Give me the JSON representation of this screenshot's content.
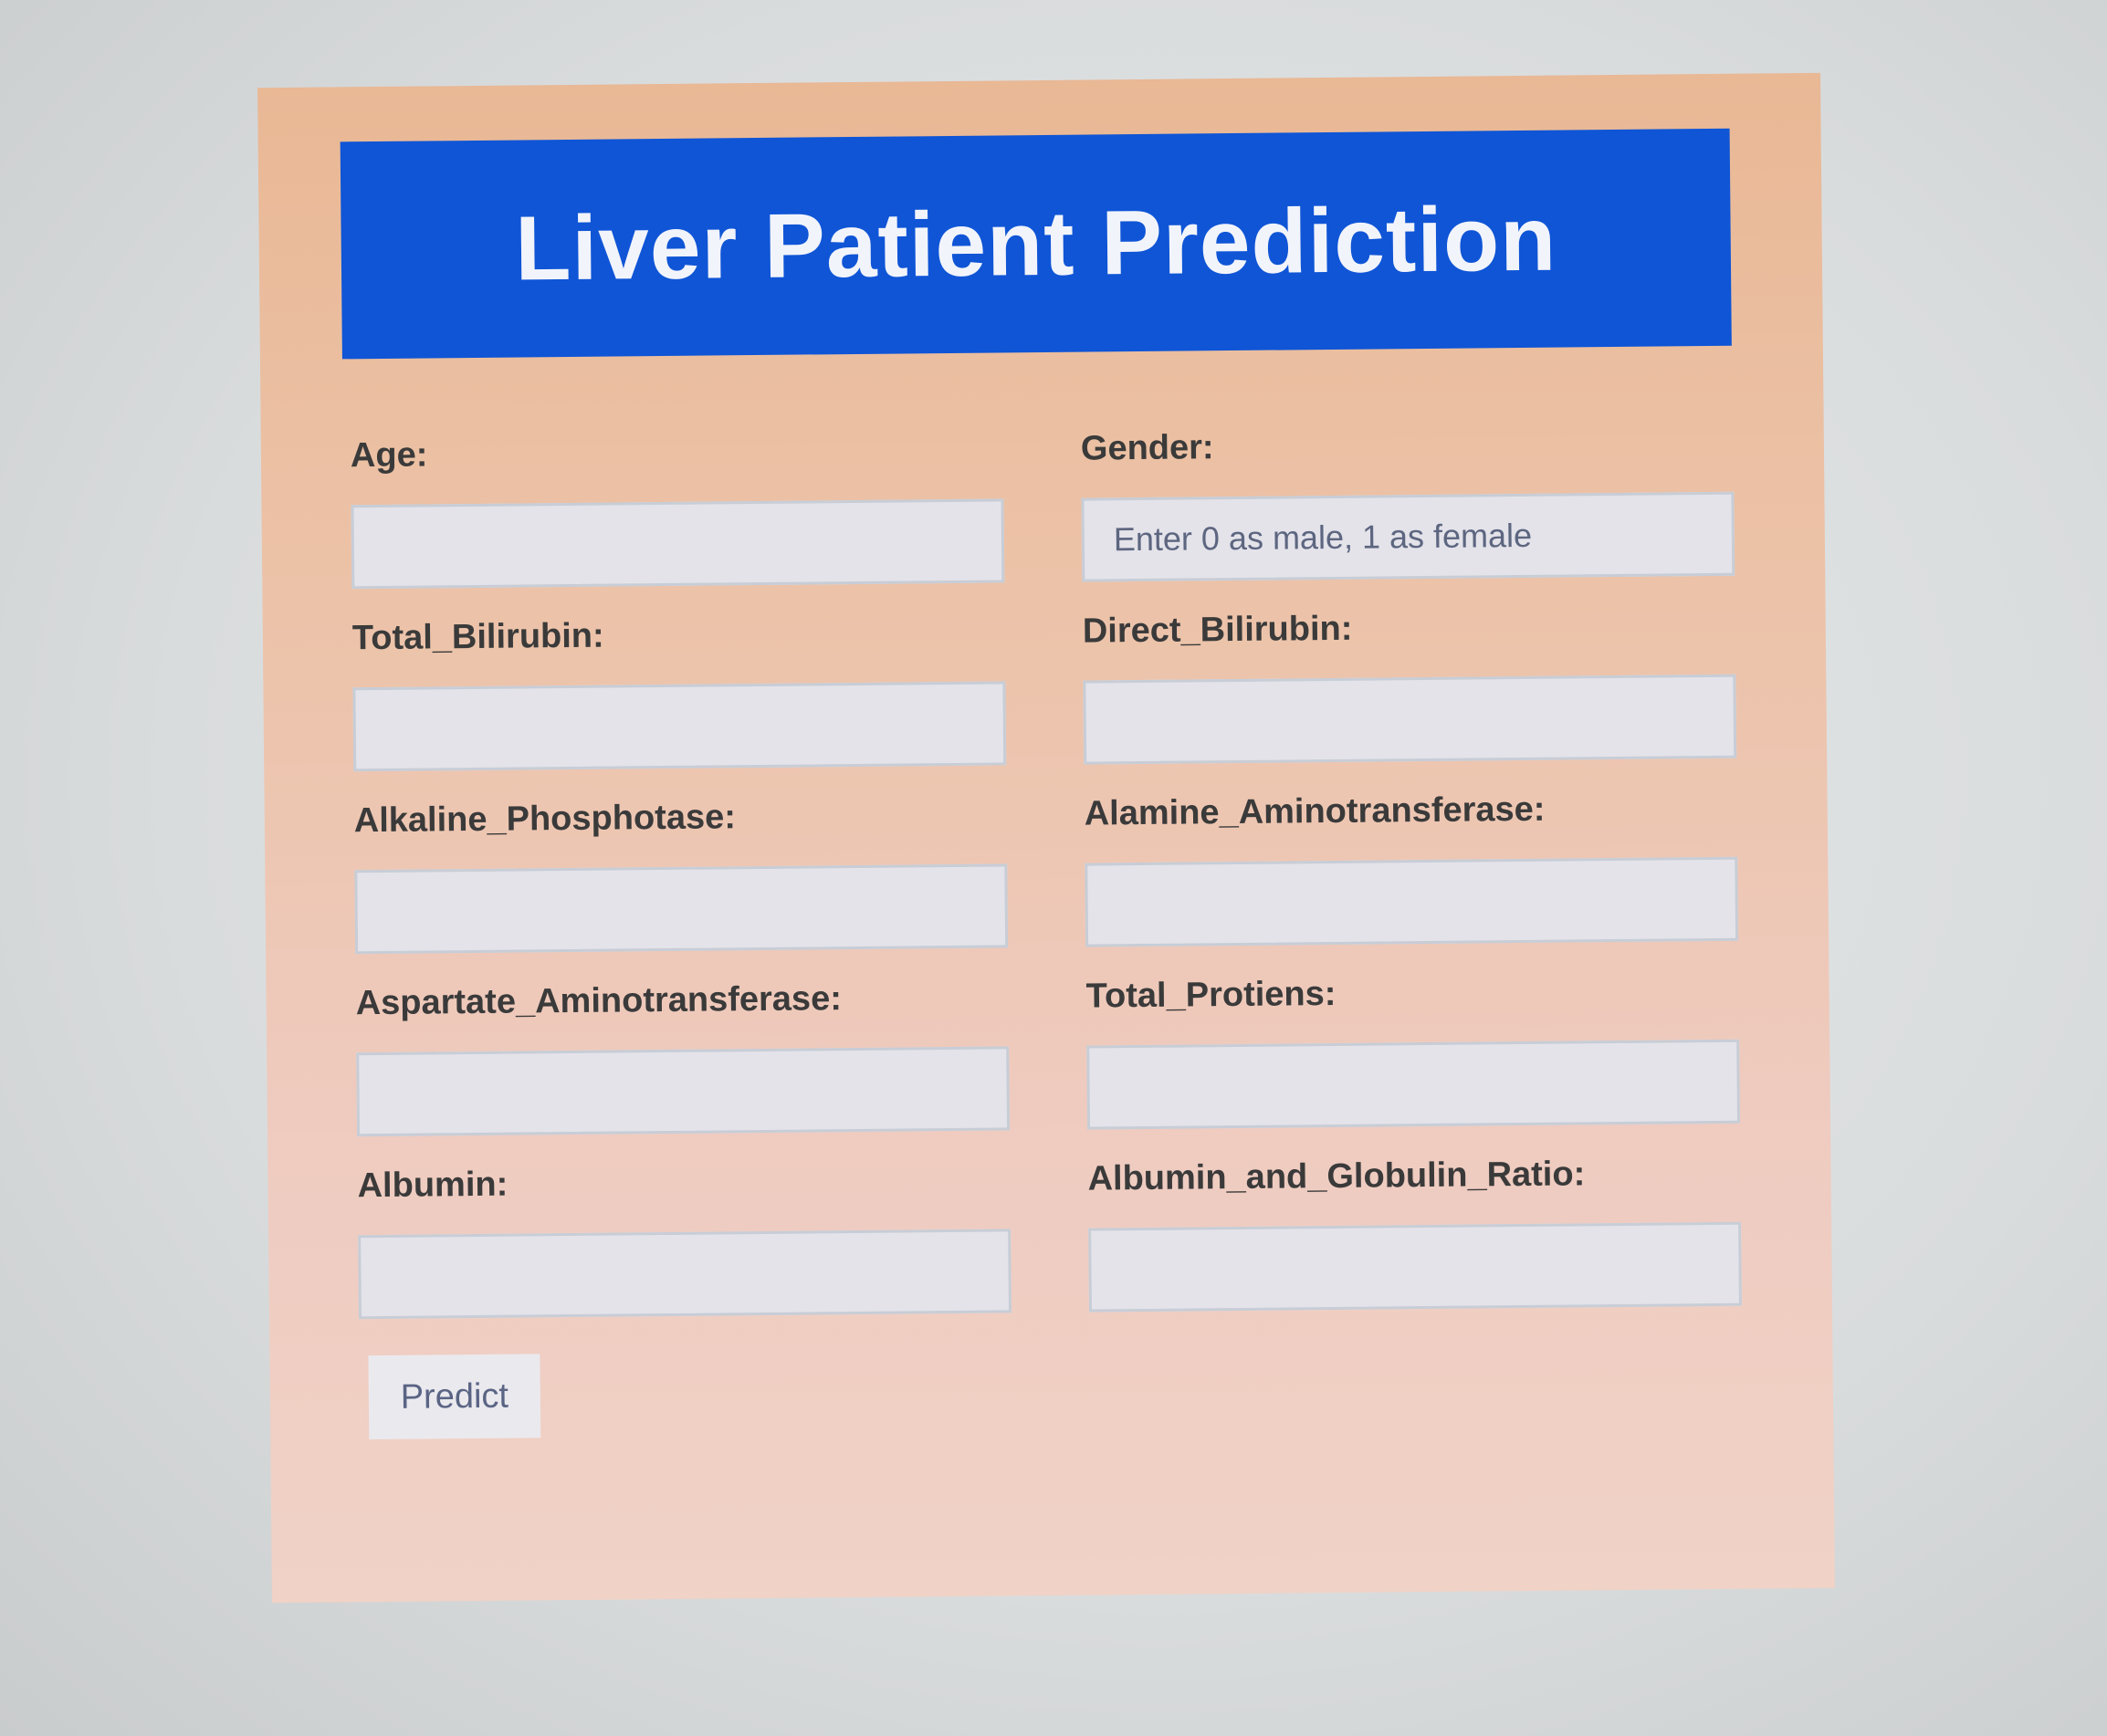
{
  "header": {
    "title": "Liver Patient Prediction"
  },
  "form": {
    "fields": [
      {
        "label": "Age:",
        "placeholder": "",
        "value": ""
      },
      {
        "label": "Gender:",
        "placeholder": "Enter 0 as male, 1 as female",
        "value": ""
      },
      {
        "label": "Total_Bilirubin:",
        "placeholder": "",
        "value": ""
      },
      {
        "label": "Direct_Bilirubin:",
        "placeholder": "",
        "value": ""
      },
      {
        "label": "Alkaline_Phosphotase:",
        "placeholder": "",
        "value": ""
      },
      {
        "label": "Alamine_Aminotransferase:",
        "placeholder": "",
        "value": ""
      },
      {
        "label": "Aspartate_Aminotransferase:",
        "placeholder": "",
        "value": ""
      },
      {
        "label": "Total_Protiens:",
        "placeholder": "",
        "value": ""
      },
      {
        "label": "Albumin:",
        "placeholder": "",
        "value": ""
      },
      {
        "label": "Albumin_and_Globulin_Ratio:",
        "placeholder": "",
        "value": ""
      }
    ],
    "submit_label": "Predict"
  },
  "colors": {
    "header_bg": "#0f55d6",
    "panel_bg": "#ecc3a9",
    "input_bg": "#e4e3ea"
  }
}
